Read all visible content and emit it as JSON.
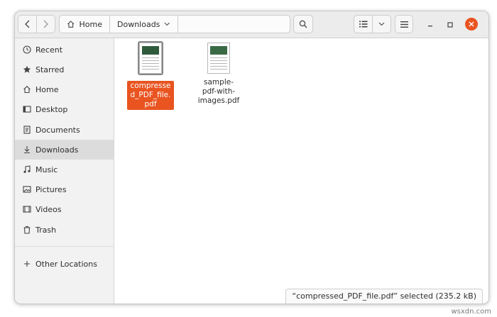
{
  "header": {
    "breadcrumbs": [
      "Home",
      "Downloads"
    ],
    "icons": [
      "back-icon",
      "forward-icon",
      "home-icon",
      "chevron-down-icon",
      "search-icon",
      "list-view-icon",
      "menu-icon",
      "minimize-icon",
      "maximize-icon",
      "close-icon"
    ]
  },
  "sidebar": {
    "items": [
      {
        "label": "Recent",
        "icon": "clock-icon"
      },
      {
        "label": "Starred",
        "icon": "star-icon"
      },
      {
        "label": "Home",
        "icon": "home-icon"
      },
      {
        "label": "Desktop",
        "icon": "desktop-icon"
      },
      {
        "label": "Documents",
        "icon": "document-icon"
      },
      {
        "label": "Downloads",
        "icon": "download-icon",
        "active": true
      },
      {
        "label": "Music",
        "icon": "music-icon"
      },
      {
        "label": "Pictures",
        "icon": "picture-icon"
      },
      {
        "label": "Videos",
        "icon": "video-icon"
      },
      {
        "label": "Trash",
        "icon": "trash-icon"
      },
      {
        "label": "Other Locations",
        "icon": "plus-icon"
      }
    ]
  },
  "files": [
    {
      "name": "compressed_PDF_file.pdf",
      "label_lines": [
        "compresse",
        "d_PDF_file.",
        "pdf"
      ],
      "selected": true
    },
    {
      "name": "sample-pdf-with-images.pdf",
      "label_lines": [
        "sample-",
        "pdf-with-",
        "images.pdf"
      ],
      "selected": false
    }
  ],
  "status": {
    "text": "“compressed_PDF_file.pdf” selected  (235.2 kB)"
  },
  "watermark": "wsxdn.com",
  "colors": {
    "accent": "#e95420",
    "sidebar_active": "#dcdcdc"
  }
}
